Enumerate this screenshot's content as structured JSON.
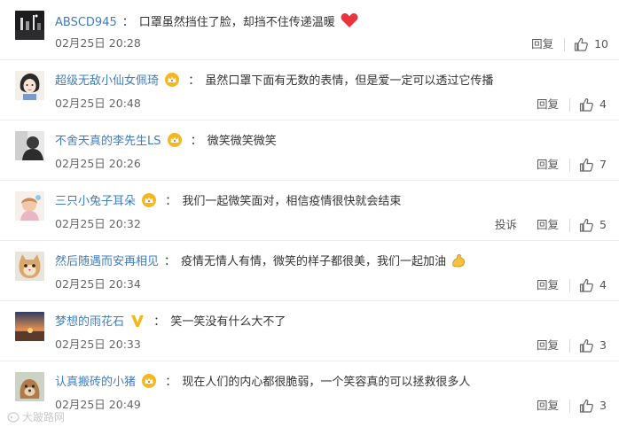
{
  "comments": [
    {
      "username": "ABSCD945",
      "colon": "：",
      "text": "口罩虽然挡住了脸，却挡不住传递温暖",
      "time": "02月25日 20:28",
      "reply": "回复",
      "likes": "10",
      "avatar": "night-city-avatar",
      "crown": false,
      "v_badge": false,
      "emoji": "heart-emoji",
      "report": ""
    },
    {
      "username": "超级无敌小仙女佩琦",
      "colon": "：",
      "text": "虽然口罩下面有无数的表情，但是爱一定可以透过它传播",
      "time": "02月25日 20:48",
      "reply": "回复",
      "likes": "4",
      "avatar": "cartoon-girl-avatar",
      "crown": true,
      "v_badge": false,
      "emoji": "",
      "report": ""
    },
    {
      "username": "不舍天真的李先生LS",
      "colon": "：",
      "text": "微笑微笑微笑",
      "time": "02月25日 20:26",
      "reply": "回复",
      "likes": "7",
      "avatar": "bw-person-avatar",
      "crown": true,
      "v_badge": false,
      "emoji": "",
      "report": ""
    },
    {
      "username": "三只小兔子耳朵",
      "colon": "：",
      "text": "我们一起微笑面对，相信疫情很快就会结束",
      "time": "02月25日 20:32",
      "reply": "回复",
      "likes": "5",
      "avatar": "illustrated-avatar",
      "crown": true,
      "v_badge": false,
      "emoji": "",
      "report": "投诉"
    },
    {
      "username": "然后随遇而安再相见",
      "colon": "：",
      "text": "疫情无情人有情，微笑的样子都很美，我们一起加油",
      "time": "02月25日 20:34",
      "reply": "回复",
      "likes": "4",
      "avatar": "cat-avatar",
      "crown": false,
      "v_badge": false,
      "emoji": "flexed-arm-emoji",
      "report": ""
    },
    {
      "username": "梦想的雨花石",
      "colon": "：",
      "text": "笑一笑没有什么大不了",
      "time": "02月25日 20:33",
      "reply": "回复",
      "likes": "3",
      "avatar": "sunset-avatar",
      "crown": false,
      "v_badge": true,
      "emoji": "",
      "report": ""
    },
    {
      "username": "认真搬砖的小猪",
      "colon": "：",
      "text": "现在人们的内心都很脆弱，一个笑容真的可以拯救很多人",
      "time": "02月25日 20:49",
      "reply": "回复",
      "likes": "3",
      "avatar": "dog-avatar",
      "crown": true,
      "v_badge": false,
      "emoji": "",
      "report": ""
    }
  ],
  "watermark": "大跛路网",
  "colors": {
    "username": "#3f7dc1",
    "text": "#333333",
    "meta": "#666666",
    "crown": "#f5b81c",
    "heart": "#e8343b"
  }
}
